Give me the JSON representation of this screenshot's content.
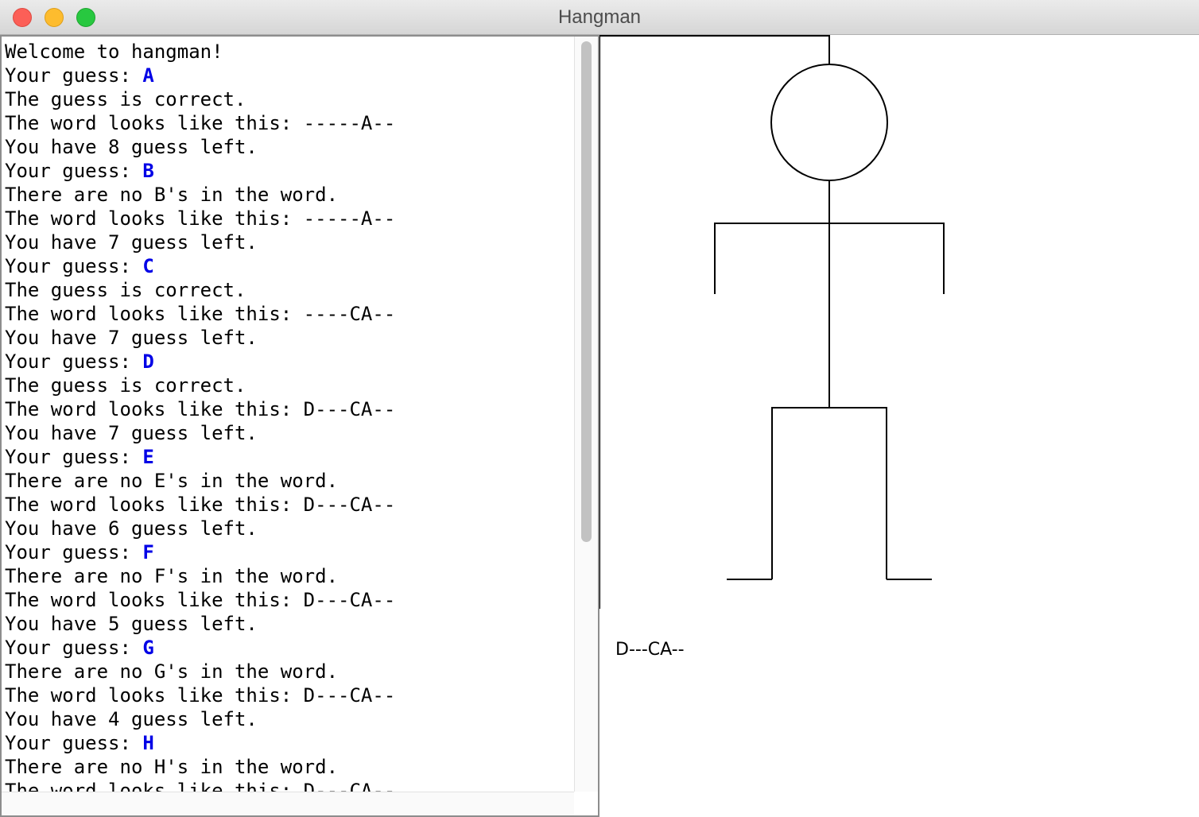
{
  "window": {
    "title": "Hangman"
  },
  "console": {
    "lines": [
      {
        "text": "Welcome to hangman!"
      },
      {
        "text": "Your guess: ",
        "guess": "A"
      },
      {
        "text": "The guess is correct."
      },
      {
        "text": "The word looks like this: -----A--"
      },
      {
        "text": "You have 8 guess left."
      },
      {
        "text": "Your guess: ",
        "guess": "B"
      },
      {
        "text": "There are no B's in the word."
      },
      {
        "text": "The word looks like this: -----A--"
      },
      {
        "text": "You have 7 guess left."
      },
      {
        "text": "Your guess: ",
        "guess": "C"
      },
      {
        "text": "The guess is correct."
      },
      {
        "text": "The word looks like this: ----CA--"
      },
      {
        "text": "You have 7 guess left."
      },
      {
        "text": "Your guess: ",
        "guess": "D"
      },
      {
        "text": "The guess is correct."
      },
      {
        "text": "The word looks like this: D---CA--"
      },
      {
        "text": "You have 7 guess left."
      },
      {
        "text": "Your guess: ",
        "guess": "E"
      },
      {
        "text": "There are no E's in the word."
      },
      {
        "text": "The word looks like this: D---CA--"
      },
      {
        "text": "You have 6 guess left."
      },
      {
        "text": "Your guess: ",
        "guess": "F"
      },
      {
        "text": "There are no F's in the word."
      },
      {
        "text": "The word looks like this: D---CA--"
      },
      {
        "text": "You have 5 guess left."
      },
      {
        "text": "Your guess: ",
        "guess": "G"
      },
      {
        "text": "There are no G's in the word."
      },
      {
        "text": "The word looks like this: D---CA--"
      },
      {
        "text": "You have 4 guess left."
      },
      {
        "text": "Your guess: ",
        "guess": "H"
      },
      {
        "text": "There are no H's in the word."
      },
      {
        "text": "The word looks like this: D---CA--"
      }
    ]
  },
  "canvas": {
    "word_display": "D---CA--",
    "body_parts_drawn": [
      "head",
      "body",
      "left-arm",
      "right-arm",
      "left-leg",
      "right-leg",
      "left-foot",
      "right-foot"
    ]
  },
  "colors": {
    "guess": "#0000e6",
    "drawing": "#000000"
  }
}
